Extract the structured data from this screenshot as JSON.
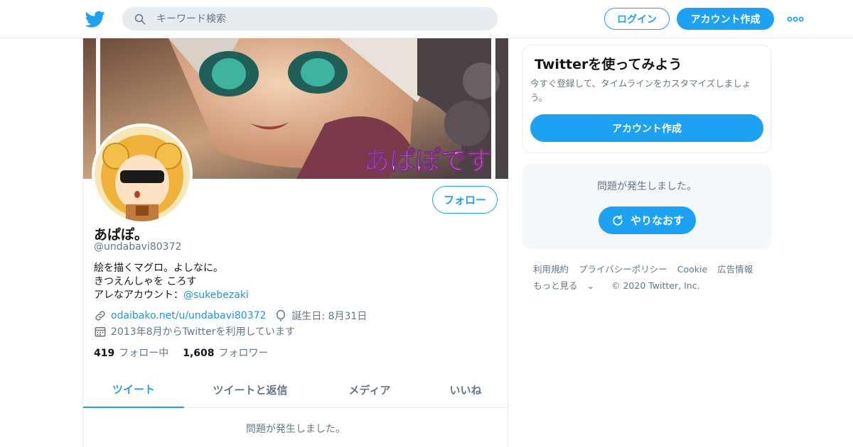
{
  "header": {
    "search_placeholder": "キーワード検索",
    "login_label": "ログイン",
    "signup_label": "アカウント作成",
    "logo_icon": "twitter-bird-icon",
    "more_icon": "more-dots-icon",
    "search_icon": "search-icon"
  },
  "profile": {
    "display_name": "あぱぽ。",
    "handle": "@undabavi80372",
    "follow_label": "フォロー",
    "banner_text": "あぱぽです",
    "bio": {
      "line1": "絵を描くマグロ。よしなに。",
      "line2": "きつえんしゃを ころす",
      "line3_prefix": "アレなアカウント：",
      "line3_link": "@sukebezaki"
    },
    "website": "odaibako.net/u/undabavi80372",
    "birthday": "誕生日: 8月31日",
    "joined": "2013年8月からTwitterを利用しています",
    "following_count": "419",
    "following_label": "フォロー中",
    "followers_count": "1,608",
    "followers_label": "フォロワー"
  },
  "tabs": [
    {
      "label": "ツイート",
      "active": true
    },
    {
      "label": "ツイートと返信",
      "active": false
    },
    {
      "label": "メディア",
      "active": false
    },
    {
      "label": "いいね",
      "active": false
    }
  ],
  "timeline": {
    "error_message": "問題が発生しました。"
  },
  "sidebar": {
    "signup_card": {
      "title": "Twitterを使ってみよう",
      "description": "今すぐ登録して、タイムラインをカスタマイズしましょう。",
      "button_label": "アカウント作成"
    },
    "error_card": {
      "message": "問題が発生しました。",
      "retry_label": "やりなおす"
    },
    "footer": {
      "terms": "利用規約",
      "privacy": "プライバシーポリシー",
      "cookie": "Cookie",
      "ads": "広告情報",
      "more": "もっと見る",
      "copyright": "© 2020 Twitter, Inc."
    }
  },
  "colors": {
    "accent": "#1da1f2",
    "link": "#1b95e0",
    "muted": "#657786",
    "border": "#e6ecf0",
    "panel": "#f5f8fa"
  }
}
